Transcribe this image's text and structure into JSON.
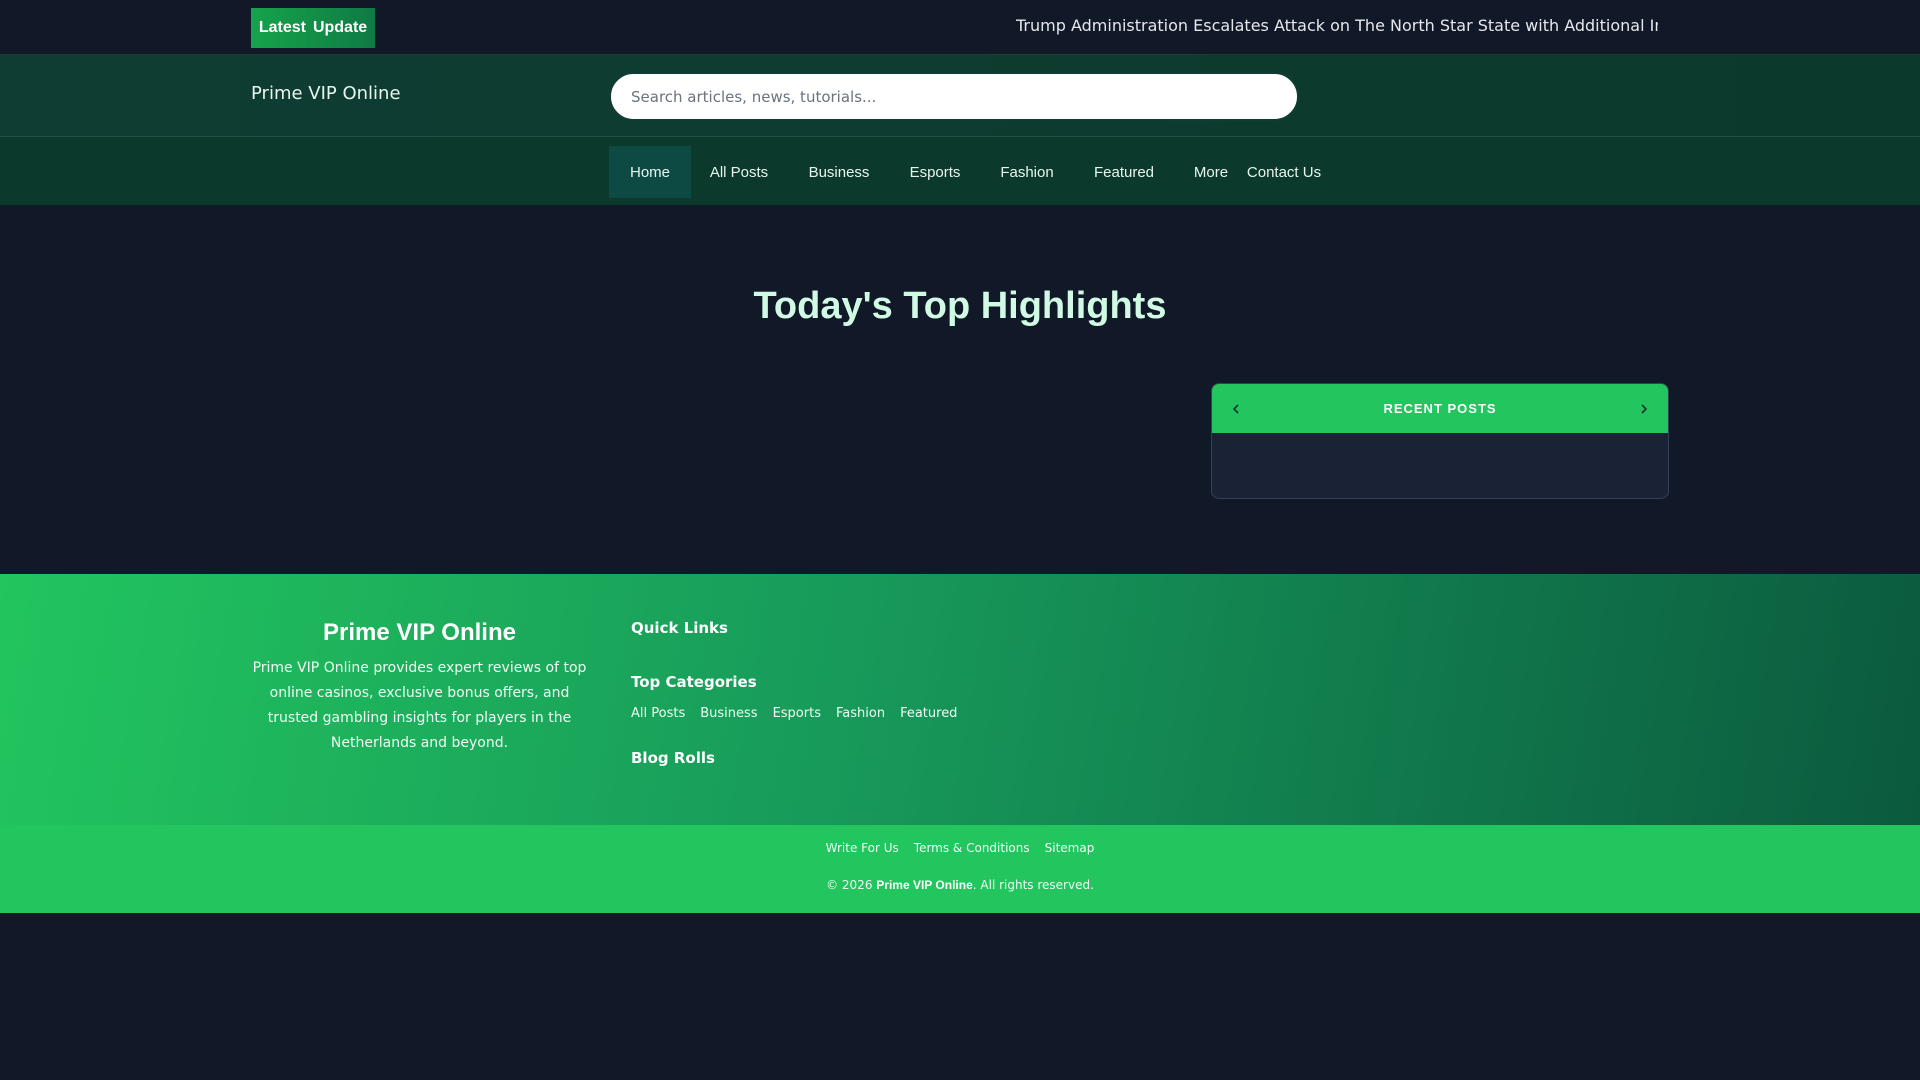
{
  "topbar": {
    "badge_word1": "Latest",
    "badge_word2": "Update",
    "ticker_text": "Trump Administration Escalates Attack on The North Star State with Additional Immigrati"
  },
  "header": {
    "brand": "Prime VIP Online",
    "search_placeholder": "Search articles, news, tutorials..."
  },
  "nav": {
    "items": [
      {
        "label": "Home",
        "active": true
      },
      {
        "label": "All Posts"
      },
      {
        "label": "Business"
      },
      {
        "label": "Esports"
      },
      {
        "label": "Fashion"
      },
      {
        "label": "Featured"
      },
      {
        "label": "More"
      },
      {
        "label": "Contact Us"
      }
    ]
  },
  "main": {
    "headline": "Today's Top Highlights",
    "recent_posts_title": "RECENT POSTS",
    "prev_icon": "chevron-left-icon",
    "next_icon": "chevron-right-icon"
  },
  "footer": {
    "brand": "Prime VIP Online",
    "description": "Prime VIP Online provides expert reviews of top online casinos, exclusive bonus offers, and trusted gambling insights for players in the Netherlands and beyond.",
    "quick_links_title": "Quick Links",
    "top_categories_title": "Top Categories",
    "categories": [
      "All Posts",
      "Business",
      "Esports",
      "Fashion",
      "Featured"
    ],
    "blog_rolls_title": "Blog Rolls"
  },
  "bottom": {
    "links": [
      "Write For Us",
      "Terms & Conditions",
      "Sitemap"
    ],
    "copyright_prefix": "© 2026",
    "copyright_brand": "Prime VIP Online",
    "copyright_suffix": ". All rights reserved."
  },
  "colors": {
    "accent": "#22c55e",
    "dark_bg": "#111827",
    "header_bg": "#0b3a2c"
  }
}
